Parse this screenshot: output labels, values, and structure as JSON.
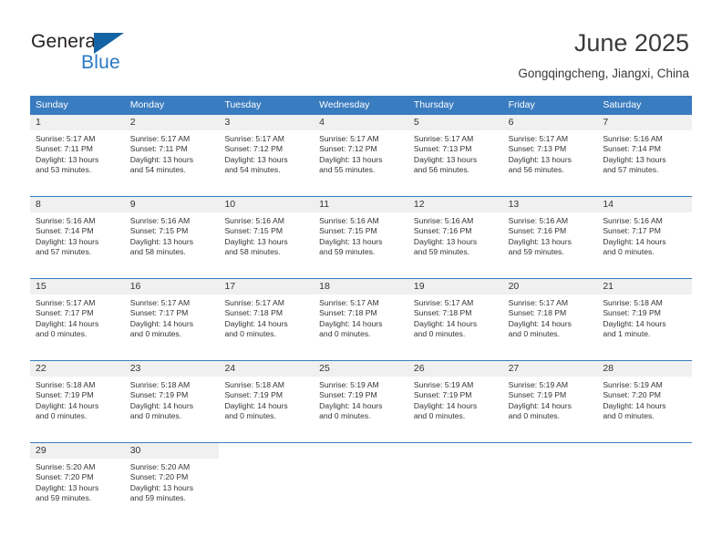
{
  "brand": {
    "name_part1": "General",
    "name_part2": "Blue",
    "flag_icon": "blue-triangle-flag",
    "accent_color": "#2a79c3"
  },
  "header": {
    "title": "June 2025",
    "subtitle": "Gongqingcheng, Jiangxi, China"
  },
  "calendar": {
    "header_background": "#3a7cc0",
    "daynum_background": "#f0f0f0",
    "weekday_names": [
      "Sunday",
      "Monday",
      "Tuesday",
      "Wednesday",
      "Thursday",
      "Friday",
      "Saturday"
    ],
    "weeks": [
      [
        {
          "day": "1",
          "sunrise": "Sunrise: 5:17 AM",
          "sunset": "Sunset: 7:11 PM",
          "daylight_line1": "Daylight: 13 hours",
          "daylight_line2": "and 53 minutes."
        },
        {
          "day": "2",
          "sunrise": "Sunrise: 5:17 AM",
          "sunset": "Sunset: 7:11 PM",
          "daylight_line1": "Daylight: 13 hours",
          "daylight_line2": "and 54 minutes."
        },
        {
          "day": "3",
          "sunrise": "Sunrise: 5:17 AM",
          "sunset": "Sunset: 7:12 PM",
          "daylight_line1": "Daylight: 13 hours",
          "daylight_line2": "and 54 minutes."
        },
        {
          "day": "4",
          "sunrise": "Sunrise: 5:17 AM",
          "sunset": "Sunset: 7:12 PM",
          "daylight_line1": "Daylight: 13 hours",
          "daylight_line2": "and 55 minutes."
        },
        {
          "day": "5",
          "sunrise": "Sunrise: 5:17 AM",
          "sunset": "Sunset: 7:13 PM",
          "daylight_line1": "Daylight: 13 hours",
          "daylight_line2": "and 56 minutes."
        },
        {
          "day": "6",
          "sunrise": "Sunrise: 5:17 AM",
          "sunset": "Sunset: 7:13 PM",
          "daylight_line1": "Daylight: 13 hours",
          "daylight_line2": "and 56 minutes."
        },
        {
          "day": "7",
          "sunrise": "Sunrise: 5:16 AM",
          "sunset": "Sunset: 7:14 PM",
          "daylight_line1": "Daylight: 13 hours",
          "daylight_line2": "and 57 minutes."
        }
      ],
      [
        {
          "day": "8",
          "sunrise": "Sunrise: 5:16 AM",
          "sunset": "Sunset: 7:14 PM",
          "daylight_line1": "Daylight: 13 hours",
          "daylight_line2": "and 57 minutes."
        },
        {
          "day": "9",
          "sunrise": "Sunrise: 5:16 AM",
          "sunset": "Sunset: 7:15 PM",
          "daylight_line1": "Daylight: 13 hours",
          "daylight_line2": "and 58 minutes."
        },
        {
          "day": "10",
          "sunrise": "Sunrise: 5:16 AM",
          "sunset": "Sunset: 7:15 PM",
          "daylight_line1": "Daylight: 13 hours",
          "daylight_line2": "and 58 minutes."
        },
        {
          "day": "11",
          "sunrise": "Sunrise: 5:16 AM",
          "sunset": "Sunset: 7:15 PM",
          "daylight_line1": "Daylight: 13 hours",
          "daylight_line2": "and 59 minutes."
        },
        {
          "day": "12",
          "sunrise": "Sunrise: 5:16 AM",
          "sunset": "Sunset: 7:16 PM",
          "daylight_line1": "Daylight: 13 hours",
          "daylight_line2": "and 59 minutes."
        },
        {
          "day": "13",
          "sunrise": "Sunrise: 5:16 AM",
          "sunset": "Sunset: 7:16 PM",
          "daylight_line1": "Daylight: 13 hours",
          "daylight_line2": "and 59 minutes."
        },
        {
          "day": "14",
          "sunrise": "Sunrise: 5:16 AM",
          "sunset": "Sunset: 7:17 PM",
          "daylight_line1": "Daylight: 14 hours",
          "daylight_line2": "and 0 minutes."
        }
      ],
      [
        {
          "day": "15",
          "sunrise": "Sunrise: 5:17 AM",
          "sunset": "Sunset: 7:17 PM",
          "daylight_line1": "Daylight: 14 hours",
          "daylight_line2": "and 0 minutes."
        },
        {
          "day": "16",
          "sunrise": "Sunrise: 5:17 AM",
          "sunset": "Sunset: 7:17 PM",
          "daylight_line1": "Daylight: 14 hours",
          "daylight_line2": "and 0 minutes."
        },
        {
          "day": "17",
          "sunrise": "Sunrise: 5:17 AM",
          "sunset": "Sunset: 7:18 PM",
          "daylight_line1": "Daylight: 14 hours",
          "daylight_line2": "and 0 minutes."
        },
        {
          "day": "18",
          "sunrise": "Sunrise: 5:17 AM",
          "sunset": "Sunset: 7:18 PM",
          "daylight_line1": "Daylight: 14 hours",
          "daylight_line2": "and 0 minutes."
        },
        {
          "day": "19",
          "sunrise": "Sunrise: 5:17 AM",
          "sunset": "Sunset: 7:18 PM",
          "daylight_line1": "Daylight: 14 hours",
          "daylight_line2": "and 0 minutes."
        },
        {
          "day": "20",
          "sunrise": "Sunrise: 5:17 AM",
          "sunset": "Sunset: 7:18 PM",
          "daylight_line1": "Daylight: 14 hours",
          "daylight_line2": "and 0 minutes."
        },
        {
          "day": "21",
          "sunrise": "Sunrise: 5:18 AM",
          "sunset": "Sunset: 7:19 PM",
          "daylight_line1": "Daylight: 14 hours",
          "daylight_line2": "and 1 minute."
        }
      ],
      [
        {
          "day": "22",
          "sunrise": "Sunrise: 5:18 AM",
          "sunset": "Sunset: 7:19 PM",
          "daylight_line1": "Daylight: 14 hours",
          "daylight_line2": "and 0 minutes."
        },
        {
          "day": "23",
          "sunrise": "Sunrise: 5:18 AM",
          "sunset": "Sunset: 7:19 PM",
          "daylight_line1": "Daylight: 14 hours",
          "daylight_line2": "and 0 minutes."
        },
        {
          "day": "24",
          "sunrise": "Sunrise: 5:18 AM",
          "sunset": "Sunset: 7:19 PM",
          "daylight_line1": "Daylight: 14 hours",
          "daylight_line2": "and 0 minutes."
        },
        {
          "day": "25",
          "sunrise": "Sunrise: 5:19 AM",
          "sunset": "Sunset: 7:19 PM",
          "daylight_line1": "Daylight: 14 hours",
          "daylight_line2": "and 0 minutes."
        },
        {
          "day": "26",
          "sunrise": "Sunrise: 5:19 AM",
          "sunset": "Sunset: 7:19 PM",
          "daylight_line1": "Daylight: 14 hours",
          "daylight_line2": "and 0 minutes."
        },
        {
          "day": "27",
          "sunrise": "Sunrise: 5:19 AM",
          "sunset": "Sunset: 7:19 PM",
          "daylight_line1": "Daylight: 14 hours",
          "daylight_line2": "and 0 minutes."
        },
        {
          "day": "28",
          "sunrise": "Sunrise: 5:19 AM",
          "sunset": "Sunset: 7:20 PM",
          "daylight_line1": "Daylight: 14 hours",
          "daylight_line2": "and 0 minutes."
        }
      ],
      [
        {
          "day": "29",
          "sunrise": "Sunrise: 5:20 AM",
          "sunset": "Sunset: 7:20 PM",
          "daylight_line1": "Daylight: 13 hours",
          "daylight_line2": "and 59 minutes."
        },
        {
          "day": "30",
          "sunrise": "Sunrise: 5:20 AM",
          "sunset": "Sunset: 7:20 PM",
          "daylight_line1": "Daylight: 13 hours",
          "daylight_line2": "and 59 minutes."
        },
        {
          "day": "",
          "sunrise": "",
          "sunset": "",
          "daylight_line1": "",
          "daylight_line2": ""
        },
        {
          "day": "",
          "sunrise": "",
          "sunset": "",
          "daylight_line1": "",
          "daylight_line2": ""
        },
        {
          "day": "",
          "sunrise": "",
          "sunset": "",
          "daylight_line1": "",
          "daylight_line2": ""
        },
        {
          "day": "",
          "sunrise": "",
          "sunset": "",
          "daylight_line1": "",
          "daylight_line2": ""
        },
        {
          "day": "",
          "sunrise": "",
          "sunset": "",
          "daylight_line1": "",
          "daylight_line2": ""
        }
      ]
    ]
  }
}
